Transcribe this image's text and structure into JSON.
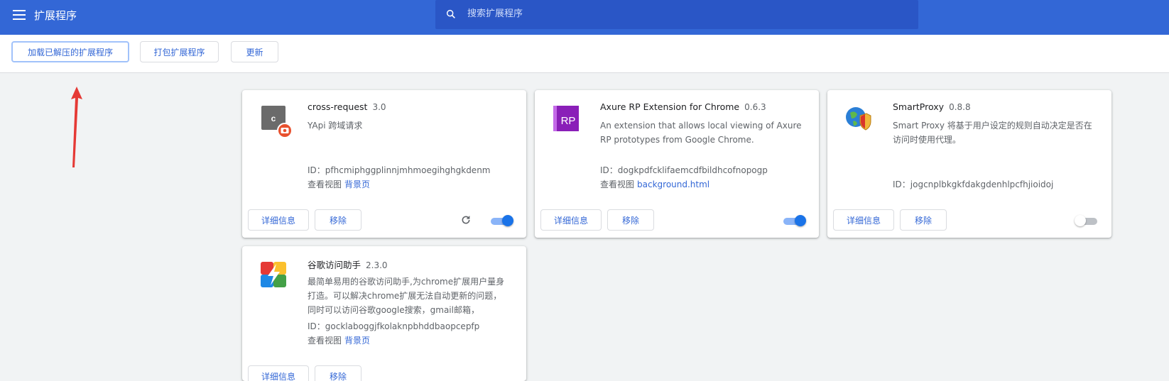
{
  "header": {
    "title": "扩展程序",
    "search_placeholder": "搜索扩展程序"
  },
  "toolbar": {
    "load_unpacked": "加载已解压的扩展程序",
    "pack": "打包扩展程序",
    "update": "更新"
  },
  "common": {
    "details": "详细信息",
    "remove": "移除",
    "inspect_views": "查看视图"
  },
  "extensions": [
    {
      "name": "cross-request",
      "version": "3.0",
      "description": "YApi 跨域请求",
      "id_label": "ID：pfhcmiphggplinnjmhmoegihghgkdenm",
      "view_link": "背景页",
      "icon": "cross-request-icon",
      "icon_letter": "c",
      "enabled": true
    },
    {
      "name": "Axure RP Extension for Chrome",
      "version": "0.6.3",
      "description": "An extension that allows local viewing of Axure RP prototypes from Google Chrome.",
      "id_label": "ID：dogkpdfcklifaemcdfbildhcofnopogp",
      "view_link": "background.html",
      "icon": "axure-rp-icon",
      "icon_letter": "RP",
      "enabled": true
    },
    {
      "name": "SmartProxy",
      "version": "0.8.8",
      "description": "Smart Proxy 将基于用户设定的规则自动决定是否在访问时使用代理。",
      "id_label": "ID：jogcnplbkgkfdakgdenhlpcfhjioidoj",
      "icon": "smartproxy-globe-shield-icon",
      "enabled": false
    },
    {
      "name": "谷歌访问助手",
      "version": "2.3.0",
      "description": "最简单易用的谷歌访问助手,为chrome扩展用户量身打造。可以解决chrome扩展无法自动更新的问题，同时可以访问谷歌google搜索，gmail邮箱，",
      "id_label": "ID：gocklaboggjfkolaknpbhddbaopcepfp",
      "view_link": "背景页",
      "icon": "google-access-helper-icon"
    }
  ],
  "colors": {
    "header": "#3367d6",
    "search": "#2a56c6",
    "link": "#3367d6",
    "toggle_on": "#1a73e8",
    "annotation_arrow": "#e53935"
  }
}
